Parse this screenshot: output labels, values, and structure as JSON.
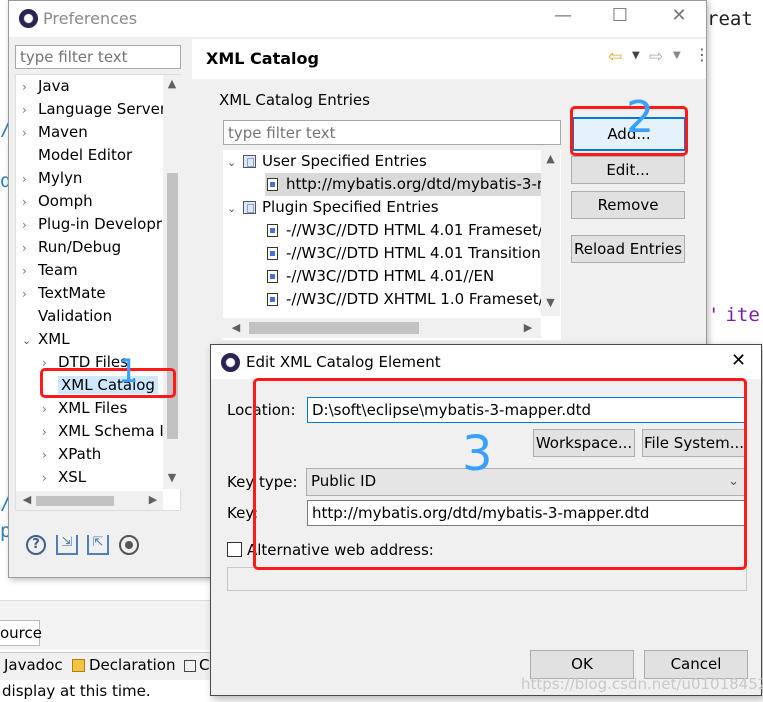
{
  "background": {
    "code_fragment_top": "reat",
    "code_fragment_mid": "ite",
    "source_tab": "ource",
    "bottom_tabs": [
      {
        "label": "Javadoc"
      },
      {
        "label": "Declaration"
      },
      {
        "label": "C"
      }
    ],
    "status_text": "display at this time.",
    "watermark": "https://blog.csdn.net/u010184528"
  },
  "preferences": {
    "title": "Preferences",
    "filter_placeholder": "type filter text",
    "page_title": "XML Catalog",
    "tree": [
      {
        "label": "Java",
        "expander": "collapsed"
      },
      {
        "label": "Language Server",
        "expander": "collapsed"
      },
      {
        "label": "Maven",
        "expander": "collapsed"
      },
      {
        "label": "Model Editor",
        "expander": "none"
      },
      {
        "label": "Mylyn",
        "expander": "collapsed"
      },
      {
        "label": "Oomph",
        "expander": "collapsed"
      },
      {
        "label": "Plug-in Developr",
        "expander": "collapsed"
      },
      {
        "label": "Run/Debug",
        "expander": "collapsed"
      },
      {
        "label": "Team",
        "expander": "collapsed"
      },
      {
        "label": "TextMate",
        "expander": "collapsed"
      },
      {
        "label": "Validation",
        "expander": "none"
      },
      {
        "label": "XML",
        "expander": "expanded"
      },
      {
        "label": "DTD Files",
        "expander": "collapsed",
        "child": true
      },
      {
        "label": "XML Catalog",
        "expander": "none",
        "child": true,
        "selected": true
      },
      {
        "label": "XML Files",
        "expander": "collapsed",
        "child": true
      },
      {
        "label": "XML Schema I",
        "expander": "collapsed",
        "child": true
      },
      {
        "label": "XPath",
        "expander": "collapsed",
        "child": true
      },
      {
        "label": "XSL",
        "expander": "collapsed",
        "child": true
      }
    ],
    "catalog_group_label": "XML Catalog Entries",
    "entries_filter_placeholder": "type filter text",
    "user_group": "User Specified Entries",
    "user_entries": [
      "http://mybatis.org/dtd/mybatis-3-r"
    ],
    "plugin_group": "Plugin Specified Entries",
    "plugin_entries": [
      "-//W3C//DTD HTML 4.01 Frameset/",
      "-//W3C//DTD HTML 4.01 Transition",
      "-//W3C//DTD HTML 4.01//EN",
      "-//W3C//DTD XHTML 1.0 Frameset/"
    ],
    "buttons": {
      "add": "Add...",
      "edit": "Edit...",
      "remove": "Remove",
      "reload": "Reload Entries"
    }
  },
  "dialog": {
    "title": "Edit XML Catalog Element",
    "location_label": "Location:",
    "location_value": "D:\\soft\\eclipse\\mybatis-3-mapper.dtd",
    "workspace_button": "Workspace...",
    "filesystem_button": "File System...",
    "key_type_label": "Key type:",
    "key_type_value": "Public ID",
    "key_label": "Key:",
    "key_value": "http://mybatis.org/dtd/mybatis-3-mapper.dtd",
    "alt_web_label": "Alternative web address:",
    "ok_button": "OK",
    "cancel_button": "Cancel"
  },
  "annotations": {
    "one": "1",
    "two": "2",
    "three": "3",
    "color_box": "#ff1a1a",
    "color_number": "#3aa0ff"
  }
}
